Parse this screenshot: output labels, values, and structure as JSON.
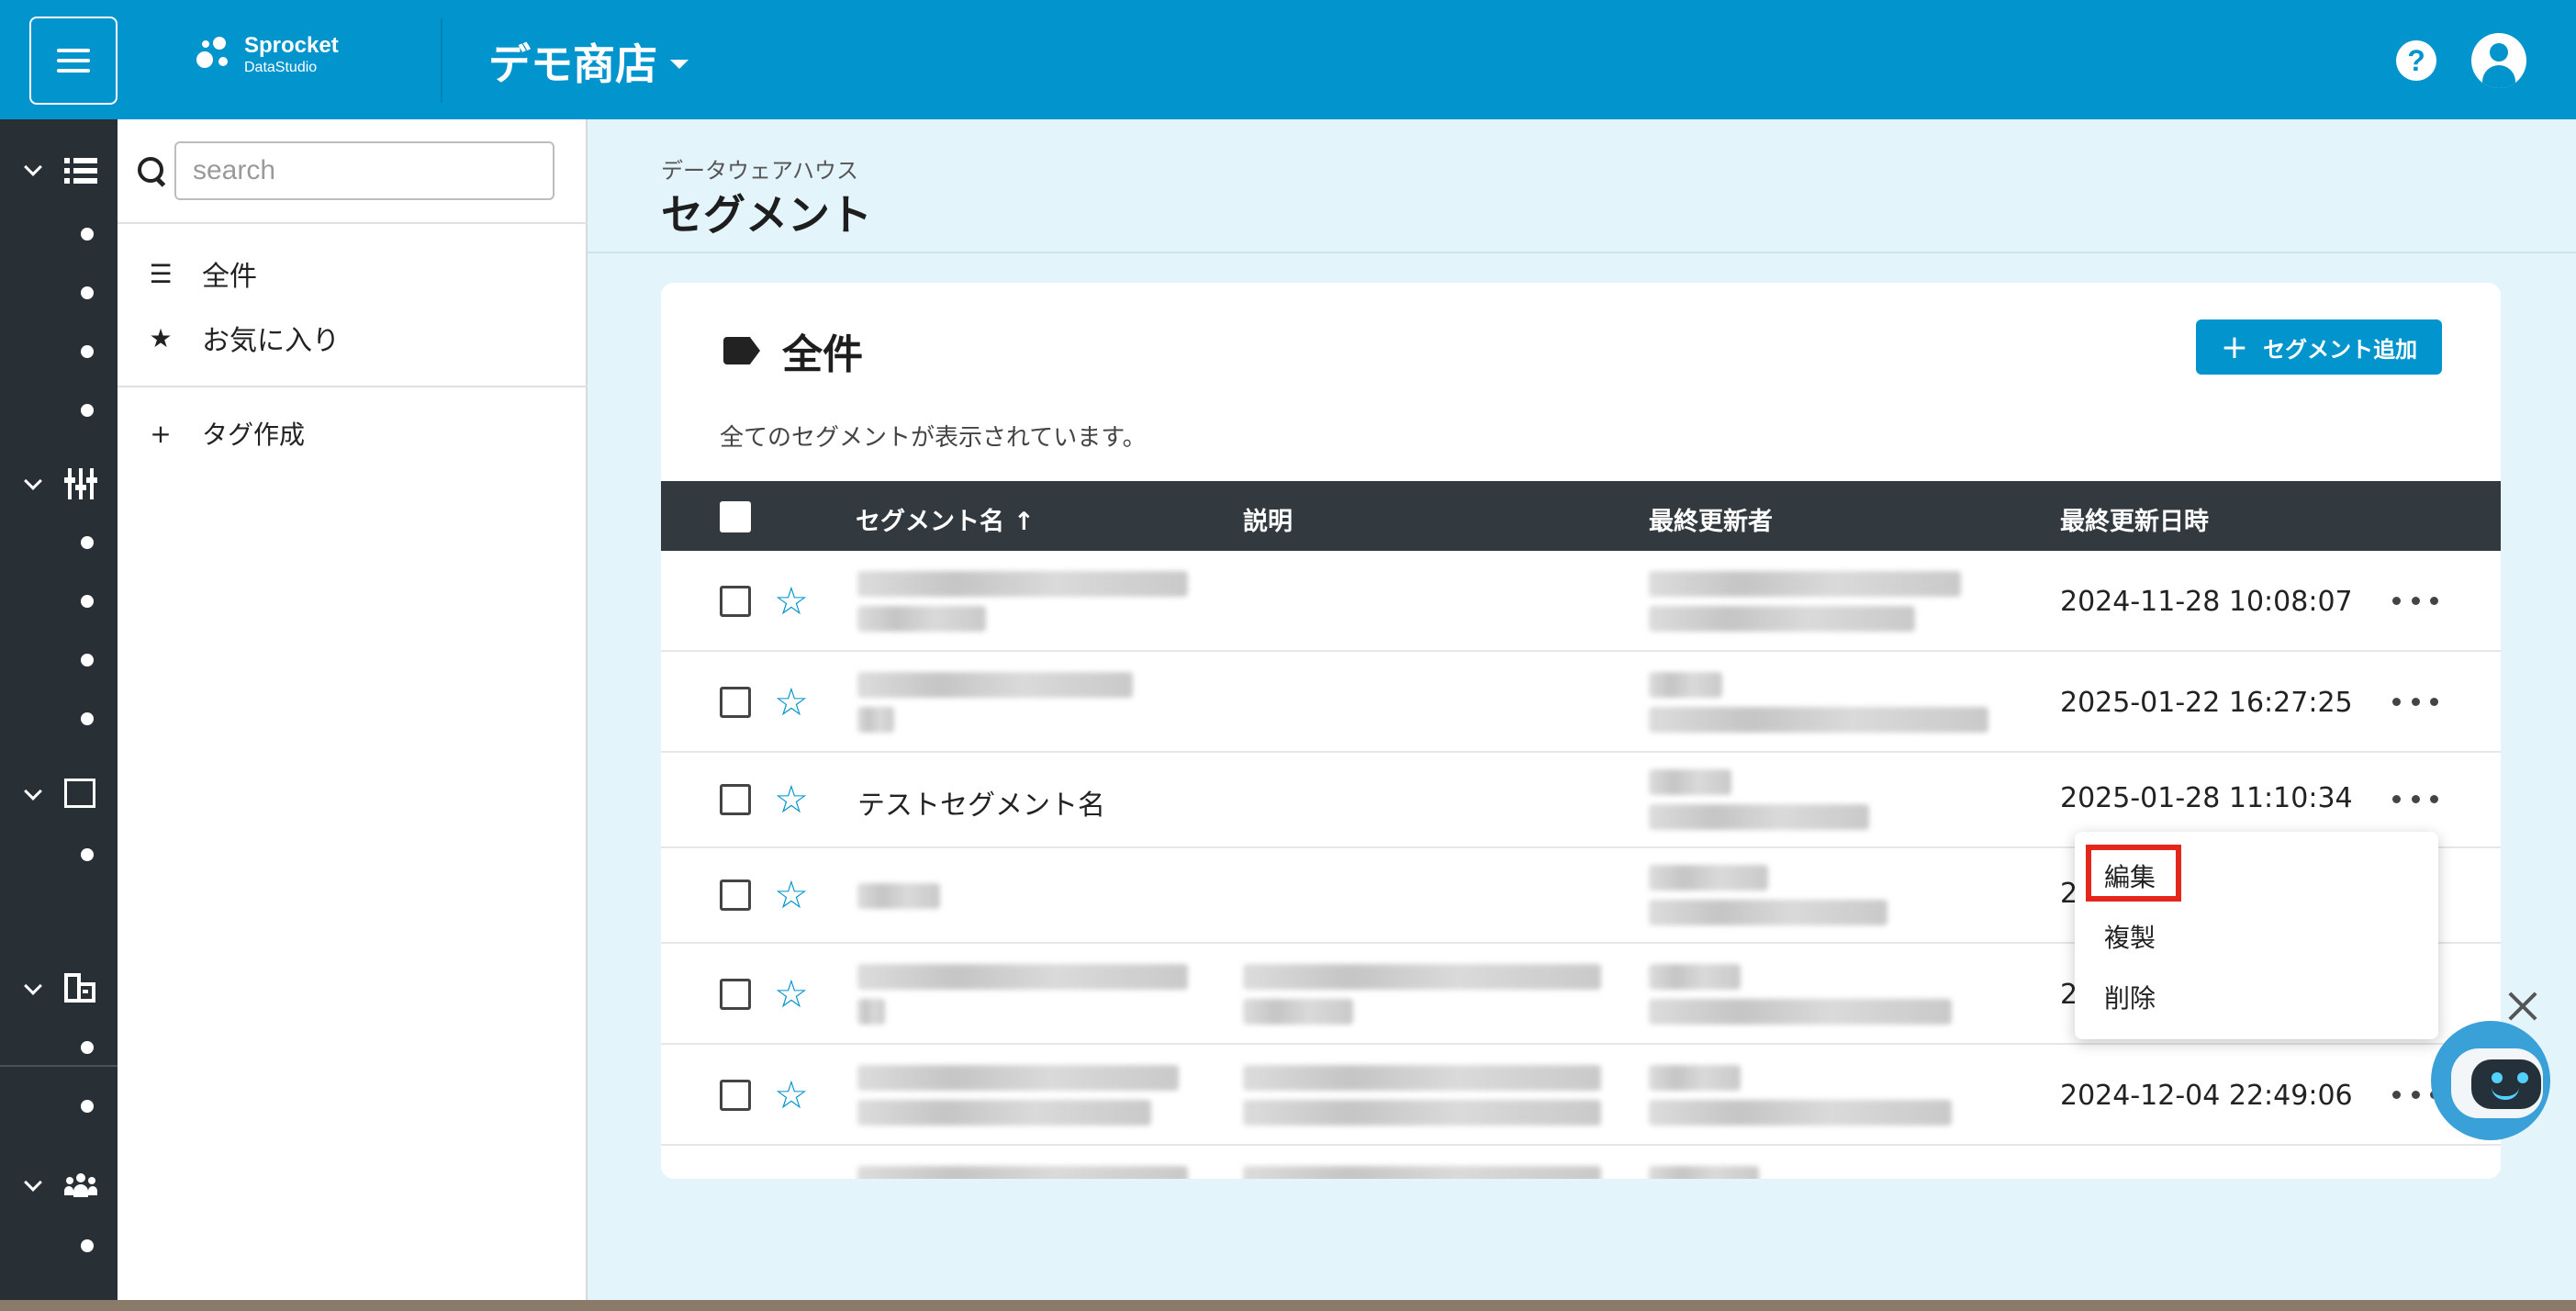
{
  "header": {
    "logo_name": "Sprocket",
    "logo_sub": "DataStudio",
    "shop_name": "デモ商店",
    "help_icon": "question-circle-icon",
    "account_icon": "account-circle-icon",
    "brand_color": "#0294cd"
  },
  "rail": {
    "sections": [
      {
        "icon": "list-view-icon",
        "dots": 4
      },
      {
        "icon": "filter-sliders-icon",
        "dots": 4
      },
      {
        "icon": "archive-box-icon",
        "dots": 1
      },
      {
        "icon": "building-icon",
        "dots": 2
      },
      {
        "icon": "people-group-icon",
        "dots": 1
      }
    ]
  },
  "panel": {
    "search_placeholder": "search",
    "items": [
      {
        "icon": "list-icon",
        "label": "全件"
      },
      {
        "icon": "star-icon",
        "label": "お気に入り"
      }
    ],
    "create_tag_label": "タグ作成"
  },
  "main": {
    "breadcrumb": "データウェアハウス",
    "title": "セグメント"
  },
  "card": {
    "title": "全件",
    "add_button": "セグメント追加",
    "description": "全てのセグメントが表示されています。",
    "columns": [
      "セグメント名",
      "説明",
      "最終更新者",
      "最終更新日時"
    ],
    "sort_indicator": "↑",
    "rows": [
      {
        "name": "",
        "updated_at": "2024-11-28 10:08:07"
      },
      {
        "name": "",
        "updated_at": "2025-01-22 16:27:25"
      },
      {
        "name": "テストセグメント名",
        "updated_at": "2025-01-28 11:10:34"
      },
      {
        "name": "",
        "updated_at": "2"
      },
      {
        "name": "",
        "updated_at": "2"
      },
      {
        "name": "",
        "updated_at": "2024-12-04 22:49:06"
      }
    ]
  },
  "menu": {
    "items": [
      "編集",
      "複製",
      "削除"
    ],
    "highlight_color": "#e5261a"
  }
}
